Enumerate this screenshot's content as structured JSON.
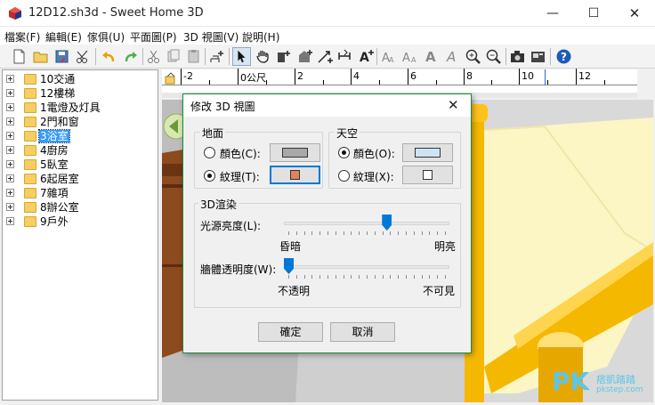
{
  "window": {
    "title": "12D12.sh3d - Sweet Home 3D",
    "minimize": "—",
    "maximize": "☐",
    "close": "✕"
  },
  "menu": [
    {
      "label": "檔案(F)"
    },
    {
      "label": "編輯(E)"
    },
    {
      "label": "傢俱(U)"
    },
    {
      "label": "平面圖(P)"
    },
    {
      "label": "3D 視圖(V)"
    },
    {
      "label": "說明(H)"
    }
  ],
  "toolbar": {
    "icons": [
      "new-file-icon",
      "open-icon",
      "save-icon",
      "cut-tool-icon",
      "undo-icon",
      "redo-icon",
      "cut-icon",
      "copy-icon",
      "paste-icon",
      "add-furniture-icon",
      "select-arrow-icon",
      "pan-hand-icon",
      "create-walls-icon",
      "create-rooms-icon",
      "create-dimensions-icon",
      "create-polylines-icon",
      "add-text-icon",
      "text-style-1-icon",
      "text-style-2-icon",
      "text-bold-icon",
      "text-italic-icon",
      "zoom-in-icon",
      "zoom-out-icon",
      "create-photo-icon",
      "create-video-icon",
      "help-icon"
    ]
  },
  "tree": {
    "items": [
      {
        "label": "10交通"
      },
      {
        "label": "12樓梯"
      },
      {
        "label": "1電燈及灯具"
      },
      {
        "label": "2門和窗"
      },
      {
        "label": "3浴室"
      },
      {
        "label": "4廚房"
      },
      {
        "label": "5臥室"
      },
      {
        "label": "6起居室"
      },
      {
        "label": "7雜項"
      },
      {
        "label": "8辦公室"
      },
      {
        "label": "9戶外"
      }
    ],
    "selected_index": 4
  },
  "ruler": {
    "labels": [
      "-2",
      "0公尺",
      "2",
      "4",
      "6",
      "8",
      "10",
      "12"
    ]
  },
  "dialog": {
    "title": "修改 3D 視圖",
    "close": "✕",
    "ground": {
      "title": "地面",
      "color_label": "顏色(C):",
      "texture_label": "紋理(T):",
      "color_swatch": "#a8a8a8",
      "texture_swatch": "#e0825a",
      "selected": "texture"
    },
    "sky": {
      "title": "天空",
      "color_label": "顏色(O):",
      "texture_label": "紋理(X):",
      "color_swatch": "#cfe3f7",
      "texture_swatch": "#ffffff",
      "selected": "color"
    },
    "render": {
      "title": "3D渲染",
      "light_label": "光源亮度(L):",
      "light_min": "昏暗",
      "light_max": "明亮",
      "light_value": 0.63,
      "wall_label": "牆體透明度(W):",
      "wall_min": "不透明",
      "wall_max": "不可見",
      "wall_value": 0.0
    },
    "ok": "確定",
    "cancel": "取消"
  },
  "watermark": {
    "text": "PK",
    "sub": "痞凱踏踏",
    "sub2": "pkstep.com"
  },
  "colors": {
    "accent": "#0078d7",
    "selection": "#3399ff",
    "bed_frame": "#f5b800",
    "mattress": "#fbf6c4"
  }
}
